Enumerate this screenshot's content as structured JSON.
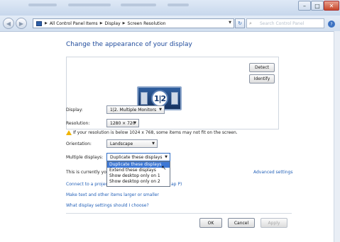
{
  "address_bar": {
    "crumbs": [
      "All Control Panel Items",
      "Display",
      "Screen Resolution"
    ],
    "search_placeholder": "Search Control Panel"
  },
  "page": {
    "title": "Change the appearance of your display",
    "detect_label": "Detect",
    "identify_label": "Identify",
    "monitor_label": "1|2"
  },
  "form": {
    "display_label": "Display:",
    "display_value": "1|2. Multiple Monitors",
    "resolution_label": "Resolution:",
    "resolution_value": "1280 × 720",
    "warning_text": "If your resolution is below 1024 x 768, some items may not fit on the screen.",
    "orientation_label": "Orientation:",
    "orientation_value": "Landscape",
    "multiple_label": "Multiple displays:",
    "multiple_value": "Duplicate these displays"
  },
  "dropdown": {
    "options": [
      "Duplicate these displays",
      "Extend these displays",
      "Show desktop only on 1",
      "Show desktop only on 2"
    ],
    "selected_index": 0
  },
  "info": {
    "currently_text": "This is currently you",
    "advanced_link": "Advanced settings",
    "projector_link": "Connect to a projec",
    "projector_suffix": "ap P)",
    "text_size_link": "Make text and other items larger or smaller",
    "what_settings_link": "What display settings should I choose?"
  },
  "buttons": {
    "ok": "OK",
    "cancel": "Cancel",
    "apply": "Apply"
  },
  "window_controls": {
    "minimize": "–",
    "maximize": "□",
    "close": "✕"
  }
}
